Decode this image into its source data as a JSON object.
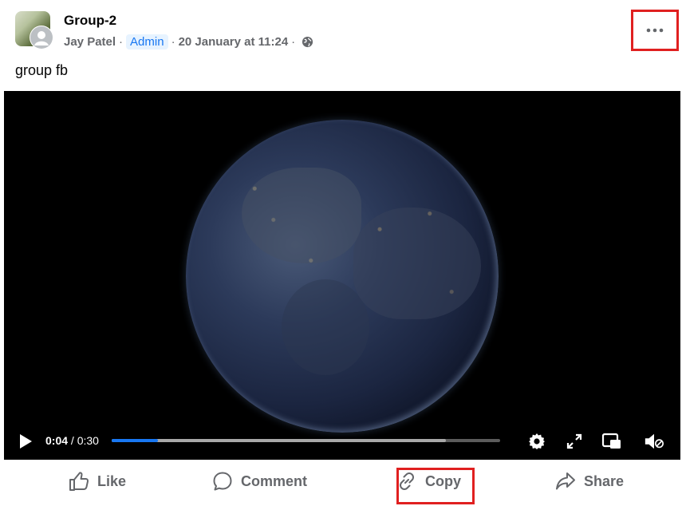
{
  "post": {
    "group_name": "Group-2",
    "author": "Jay Patel",
    "separator": "·",
    "role_badge": "Admin",
    "date": "20 January at 11:24",
    "audience_icon": "globe-icon",
    "more_icon": "more-horizontal-icon",
    "text": "group fb"
  },
  "video": {
    "current_time": "0:04",
    "total_time": "/ 0:30",
    "played_fraction": 0.12,
    "buffered_fraction": 0.86,
    "icons": [
      "play-icon",
      "settings-icon",
      "fullscreen-icon",
      "picture-in-picture-icon",
      "mute-icon"
    ]
  },
  "actions": {
    "like": "Like",
    "comment": "Comment",
    "copy": "Copy",
    "share": "Share"
  },
  "colors": {
    "accent": "#1877f2",
    "highlight_border": "#e02020",
    "secondary_text": "#65676b"
  }
}
